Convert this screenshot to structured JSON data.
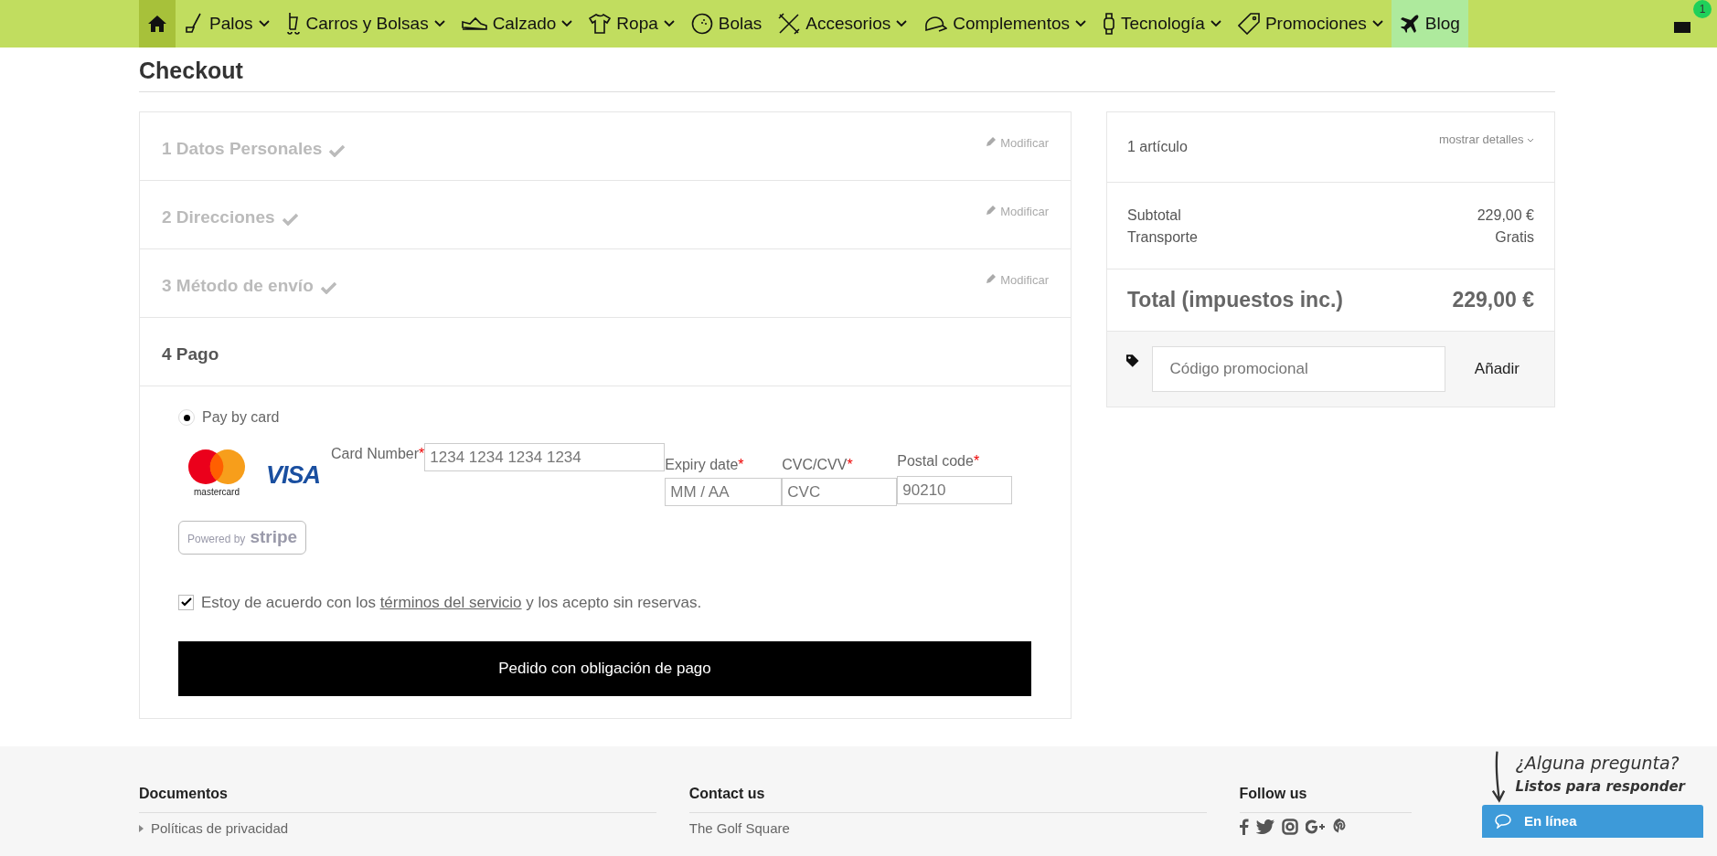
{
  "nav": {
    "items": [
      {
        "selected": true,
        "dropdown": false,
        "highlighted": false
      },
      {
        "label": "Palos",
        "selected": false,
        "dropdown": true,
        "highlighted": false
      },
      {
        "label": "Carros y Bolsas",
        "selected": false,
        "dropdown": true,
        "highlighted": false
      },
      {
        "label": "Calzado",
        "selected": false,
        "dropdown": true,
        "highlighted": false
      },
      {
        "label": "Ropa",
        "selected": false,
        "dropdown": true,
        "highlighted": false
      },
      {
        "label": "Bolas",
        "selected": false,
        "dropdown": false,
        "highlighted": false
      },
      {
        "label": "Accesorios",
        "selected": false,
        "dropdown": true,
        "highlighted": false
      },
      {
        "label": "Complementos",
        "selected": false,
        "dropdown": true,
        "highlighted": false
      },
      {
        "label": "Tecnología",
        "selected": false,
        "dropdown": true,
        "highlighted": false
      },
      {
        "label": "Promociones",
        "selected": false,
        "dropdown": true,
        "highlighted": false
      },
      {
        "label": "Blog",
        "selected": false,
        "dropdown": false,
        "highlighted": true
      }
    ],
    "cart_count": "1"
  },
  "page_title": "Checkout",
  "steps": [
    {
      "number": "1",
      "title": "Datos Personales",
      "complete": true,
      "edit": "Modificar"
    },
    {
      "number": "2",
      "title": "Direcciones",
      "complete": true,
      "edit": "Modificar"
    },
    {
      "number": "3",
      "title": "Método de envío",
      "complete": true,
      "edit": "Modificar"
    },
    {
      "number": "4",
      "title": "Pago",
      "complete": false
    }
  ],
  "payment": {
    "option": {
      "label": "Pay by card",
      "selected": true
    },
    "logos": {
      "mastercard": "mastercard",
      "visa": "VISA",
      "stripe_prefix": "Powered by",
      "stripe": "stripe"
    },
    "fields": [
      {
        "label": "Card Number",
        "required_mark": "*",
        "placeholder": "1234 1234 1234 1234"
      },
      {
        "label": "Expiry date",
        "required_mark": "*",
        "placeholder": "MM / AA"
      },
      {
        "label": "CVC/CVV",
        "required_mark": "*",
        "placeholder": "CVC"
      },
      {
        "label": "Postal code",
        "required_mark": "*",
        "placeholder": "90210"
      }
    ],
    "terms": {
      "checked": true,
      "before": "Estoy de acuerdo con los",
      "link": "términos del servicio",
      "after": "y los acepto sin reservas."
    },
    "submit": "Pedido con obligación de pago"
  },
  "summary": {
    "items_count": "1 artículo",
    "details_link": "mostrar detalles",
    "lines": [
      {
        "label": "Subtotal",
        "value": "229,00 €"
      },
      {
        "label": "Transporte",
        "value": "Gratis"
      }
    ],
    "total": {
      "label": "Total (impuestos inc.)",
      "value": "229,00 €"
    },
    "promo": {
      "placeholder": "Código promocional",
      "button": "Añadir"
    }
  },
  "footer": {
    "columns": [
      {
        "title": "Documentos",
        "links": [
          "Políticas de privacidad"
        ]
      },
      {
        "title": "Contact us",
        "links": [
          "The Golf Square"
        ]
      },
      {
        "title": "Follow us"
      }
    ]
  },
  "chat": {
    "question": "¿Alguna pregunta?",
    "subtitle": "Listos para responder",
    "status": "En línea"
  }
}
